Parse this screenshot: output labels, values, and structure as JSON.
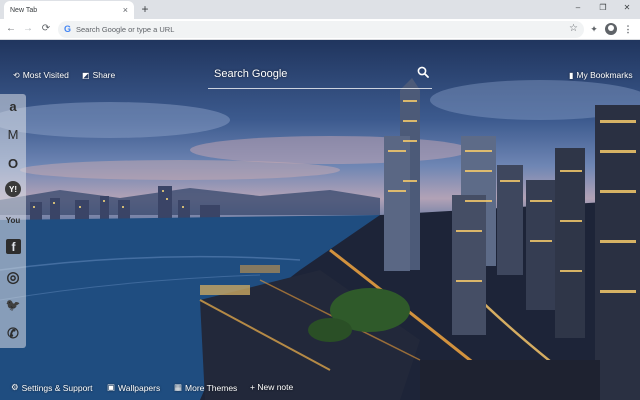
{
  "browser": {
    "tab_title": "New Tab",
    "tab_close": "×",
    "new_tab": "+",
    "window": {
      "minimize": "–",
      "restore": "❐",
      "close": "✕"
    },
    "nav": {
      "back": "←",
      "forward": "→",
      "reload": "⟳"
    },
    "omnibox": {
      "google_glyph": "G",
      "placeholder": "Search Google or type a URL"
    },
    "toolbar_icons": [
      "star-icon",
      "puzzle-icon",
      "profile-icon",
      "menu-icon"
    ],
    "menu_glyph": "⋮",
    "star_glyph": "☆",
    "extensions_glyph": "✦"
  },
  "overlay": {
    "most_visited": "Most Visited",
    "share": "Share",
    "search_label": "Search Google",
    "bookmarks": "My Bookmarks"
  },
  "sidebar": {
    "items": [
      {
        "name": "amazon",
        "glyph": "a"
      },
      {
        "name": "gmail",
        "glyph": "M"
      },
      {
        "name": "outlook",
        "glyph": "O"
      },
      {
        "name": "yahoo",
        "glyph": "Y!"
      },
      {
        "name": "youtube",
        "glyph": "You"
      },
      {
        "name": "facebook",
        "glyph": "f"
      },
      {
        "name": "instagram",
        "glyph": "◎"
      },
      {
        "name": "twitter",
        "glyph": "🐦"
      },
      {
        "name": "whatsapp",
        "glyph": "✆"
      }
    ]
  },
  "bottom": {
    "settings": "Settings & Support",
    "wallpapers": "Wallpapers",
    "more_themes": "More Themes",
    "new_note": "+ New note"
  },
  "colors": {
    "chrome_bg": "#dee1e6",
    "omnibox_bg": "#f1f3f4",
    "overlay_text": "#ffffff"
  }
}
